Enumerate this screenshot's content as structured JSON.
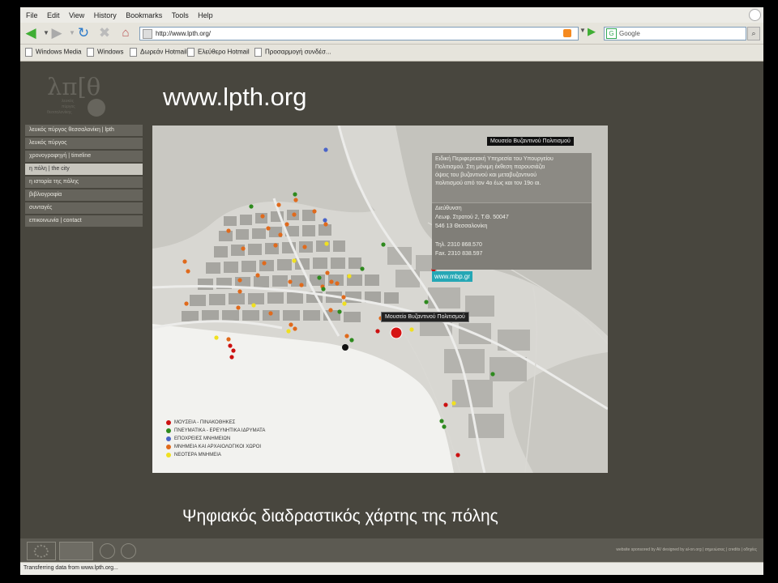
{
  "browser": {
    "menu": [
      "File",
      "Edit",
      "View",
      "History",
      "Bookmarks",
      "Tools",
      "Help"
    ],
    "url": "http://www.lpth.org/",
    "search_engine": "Google",
    "search_placeholder": "Google",
    "bookmarks": [
      "Windows Media",
      "Windows",
      "Δωρεάν Hotmail",
      "Ελεύθερο Hotmail",
      "Προσαρμογή συνδέσ..."
    ],
    "status": "Transferring data from www.lpth.org..."
  },
  "page": {
    "logo": {
      "glyph": "λπ[θ",
      "sub_lines": [
        "λευκός",
        "πύργος",
        "θεσσαλονίκης"
      ]
    },
    "site_title": "www.lpth.org",
    "nav": [
      "λευκός πύργος θεσσαλονίκη | lpth",
      "λευκός πύργος",
      "χρονογραφηγή | timeline",
      "η πόλη | the city",
      "η ιστορία της πόλης",
      "βιβλιογραφία",
      "συνταγές",
      "επικοινωνία | contact"
    ],
    "active_nav_index": 3,
    "caption": "Ψηφιακός διαδραστικός χάρτης της πόλης",
    "footer_text": "website sponsored by  AV  designed by al-on.org  |  σημειώσεις  |  credits  |  οδηγίες"
  },
  "map": {
    "popup_title": "Μουσείο Βυζαντινού Πολιτισμού",
    "popup_description": [
      "Ειδική Περιφερειακή Υπηρεσία του Υπουργείου",
      "Πολιτισμού. Στη μόνιμη έκθεση παρουσιάζει",
      "όψεις του βυζαντινού και μεταβυζαντινού",
      "πολιτισμού από τον 4ο έως και τον 19ο αι."
    ],
    "address_label": "Διεύθυνση",
    "address_line1": "Λεωφ. Στρατού 2, Τ.Θ. 50047",
    "address_line2": "546 13 Θεσσαλονίκη",
    "phone": "Τηλ. 2310 868.570",
    "fax": "Fax. 2310 838.597",
    "link": "www.mbp.gr",
    "marker_label": "Μουσείο Βυζαντινού Πολιτισμού",
    "legend": [
      {
        "label": "ΜΟΥΣΕΙΑ - ΠΙΝΑΚΟΘΗΚΕΣ",
        "color": "#cc1111"
      },
      {
        "label": "ΠΝΕΥΜΑΤΙΚΑ - ΕΡΕΥΝΗΤΙΚΑ ΙΔΡΥΜΑΤΑ",
        "color": "#2e8a1e"
      },
      {
        "label": "ΕΠΟΧΡΕΙΕΣ ΜΝΗΜΕΙΩΝ",
        "color": "#4a64c8"
      },
      {
        "label": "ΜΝΗΜΕΙΑ ΚΑΙ ΑΡΧΑΙΟΛΟΓΙΚΟΙ ΧΩΡΟΙ",
        "color": "#e06a1c"
      },
      {
        "label": "ΝΕΟΤΕΡΑ ΜΝΗΜΕΙΑ",
        "color": "#f0e020"
      }
    ],
    "colors": {
      "red": "#cc1111",
      "green": "#2e8a1e",
      "blue": "#4a64c8",
      "orange": "#e06a1c",
      "yellow": "#f0e020",
      "black": "#111111"
    }
  }
}
